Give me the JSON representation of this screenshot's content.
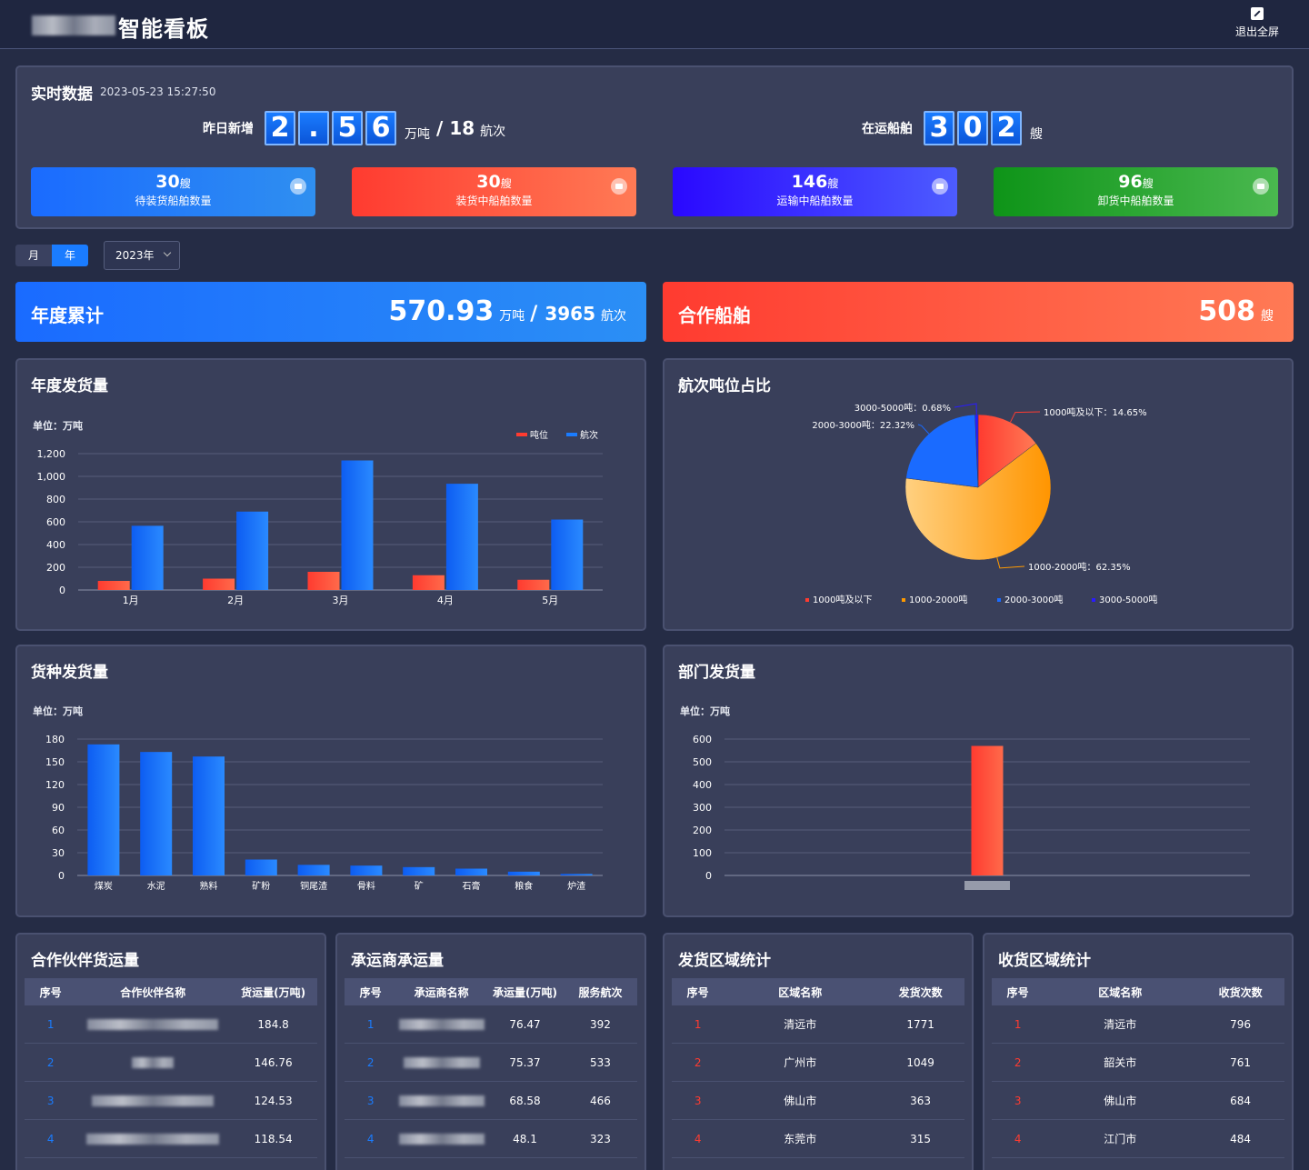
{
  "header": {
    "title": "智能看板",
    "exit_label": "退出全屏"
  },
  "realtime": {
    "title": "实时数据",
    "time": "2023-05-23 15:27:50",
    "yesterday_label": "昨日新增",
    "yesterday_digits": [
      "2",
      ".",
      "5",
      "6"
    ],
    "yesterday_unit": "万吨",
    "yesterday_sep": "/",
    "yesterday_trips": "18",
    "yesterday_trips_unit": "航次",
    "shipping_label": "在运船舶",
    "shipping_digits": [
      "3",
      "0",
      "2"
    ],
    "shipping_unit": "艘",
    "cards": [
      {
        "value": "30",
        "unit": "艘",
        "label": "待装货船舶数量",
        "color": "#1a7cff"
      },
      {
        "value": "30",
        "unit": "艘",
        "label": "装货中船舶数量",
        "color": "#ff3b30"
      },
      {
        "value": "146",
        "unit": "艘",
        "label": "运输中船舶数量",
        "color": "#2a1bff"
      },
      {
        "value": "96",
        "unit": "艘",
        "label": "卸货中船舶数量",
        "color": "#13a01d"
      }
    ]
  },
  "filters": {
    "month": "月",
    "year": "年",
    "selected_year": "2023年"
  },
  "annual": {
    "title": "年度累计",
    "value": "570.93",
    "unit": "万吨",
    "sep": "/",
    "trips": "3965",
    "trips_unit": "航次"
  },
  "coop_ships": {
    "title": "合作船舶",
    "value": "508",
    "unit": "艘"
  },
  "chart_titles": {
    "annual": "年度发货量",
    "tonnage_ratio": "航次吨位占比",
    "cargo": "货种发货量",
    "dept": "部门发货量",
    "unit": "单位：万吨"
  },
  "chart_data": [
    {
      "type": "bar",
      "title": "年度发货量",
      "ylabel": "单位：万吨",
      "categories": [
        "1月",
        "2月",
        "3月",
        "4月",
        "5月"
      ],
      "series": [
        {
          "name": "吨位",
          "values": [
            80,
            100,
            160,
            130,
            90
          ]
        },
        {
          "name": "航次",
          "values": [
            565,
            690,
            1140,
            935,
            620
          ]
        }
      ],
      "ylim": [
        0,
        1200
      ],
      "yticks": [
        "0",
        "200",
        "400",
        "600",
        "800",
        "1,000",
        "1,200"
      ],
      "legend": "top-right"
    },
    {
      "type": "pie",
      "title": "航次吨位占比",
      "categories": [
        "1000吨及以下",
        "1000-2000吨",
        "2000-3000吨",
        "3000-5000吨"
      ],
      "values": [
        14.65,
        62.35,
        22.32,
        0.68
      ],
      "labels": [
        "1000吨及以下：14.65%",
        "1000-2000吨：62.35%",
        "2000-3000吨：22.32%",
        "3000-5000吨：0.68%"
      ],
      "colors": [
        "#ff3b30",
        "#ff9a00",
        "#1a6bff",
        "#2a1bff"
      ],
      "legend": "bottom"
    },
    {
      "type": "bar",
      "title": "货种发货量",
      "ylabel": "单位：万吨",
      "categories": [
        "煤炭",
        "水泥",
        "熟料",
        "矿粉",
        "铜尾渣",
        "骨料",
        "矿",
        "石膏",
        "粮食",
        "炉渣"
      ],
      "values": [
        173,
        163,
        157,
        21,
        14,
        13,
        11,
        9,
        5,
        2
      ],
      "ylim": [
        0,
        180
      ],
      "yticks": [
        "0",
        "30",
        "60",
        "90",
        "120",
        "150",
        "180"
      ]
    },
    {
      "type": "bar",
      "title": "部门发货量",
      "ylabel": "单位：万吨",
      "categories": [
        ""
      ],
      "values": [
        570
      ],
      "ylim": [
        0,
        600
      ],
      "yticks": [
        "0",
        "100",
        "200",
        "300",
        "400",
        "500",
        "600"
      ]
    }
  ],
  "partner": {
    "title": "合作伙伴货运量",
    "headers": [
      "序号",
      "合作伙伴名称",
      "货运量(万吨)"
    ],
    "rows": [
      [
        "1",
        "",
        "184.8"
      ],
      [
        "2",
        "",
        "146.76"
      ],
      [
        "3",
        "",
        "124.53"
      ],
      [
        "4",
        "",
        "118.54"
      ]
    ]
  },
  "carrier": {
    "title": "承运商承运量",
    "headers": [
      "序号",
      "承运商名称",
      "承运量(万吨)",
      "服务航次"
    ],
    "rows": [
      [
        "1",
        "",
        "76.47",
        "392"
      ],
      [
        "2",
        "",
        "75.37",
        "533"
      ],
      [
        "3",
        "",
        "68.58",
        "466"
      ],
      [
        "4",
        "",
        "48.1",
        "323"
      ]
    ]
  },
  "origin": {
    "title": "发货区域统计",
    "headers": [
      "序号",
      "区域名称",
      "发货次数"
    ],
    "rows": [
      [
        "1",
        "清远市",
        "1771"
      ],
      [
        "2",
        "广州市",
        "1049"
      ],
      [
        "3",
        "佛山市",
        "363"
      ],
      [
        "4",
        "东莞市",
        "315"
      ]
    ]
  },
  "dest": {
    "title": "收货区域统计",
    "headers": [
      "序号",
      "区域名称",
      "收货次数"
    ],
    "rows": [
      [
        "1",
        "清远市",
        "796"
      ],
      [
        "2",
        "韶关市",
        "761"
      ],
      [
        "3",
        "佛山市",
        "684"
      ],
      [
        "4",
        "江门市",
        "484"
      ]
    ]
  }
}
